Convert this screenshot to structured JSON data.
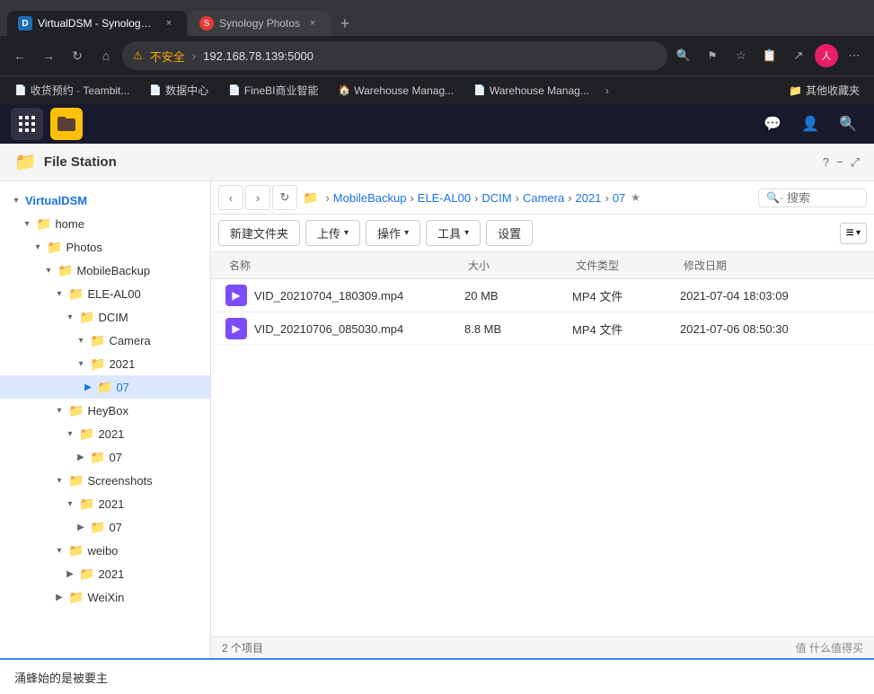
{
  "browser": {
    "tabs": [
      {
        "id": "tab1",
        "favicon_color": "#1a6fb5",
        "label": "VirtualDSM - Synology VirtualDS...",
        "active": true
      },
      {
        "id": "tab2",
        "favicon_color": "#e53935",
        "label": "Synology Photos",
        "active": false
      }
    ],
    "new_tab_label": "+",
    "address": {
      "warning_icon": "⚠",
      "warning_text": "不安全",
      "url": "192.168.78.139:5000"
    },
    "nav": {
      "back": "←",
      "forward": "→",
      "refresh": "↻",
      "home": "⌂"
    },
    "toolbar_icons": [
      "🔍",
      "⭐",
      "📋",
      "↗",
      "⋯"
    ],
    "bookmarks": [
      {
        "label": "收货预约 · Teambit..."
      },
      {
        "label": "数据中心"
      },
      {
        "label": "FineBI商业智能"
      },
      {
        "label": "Warehouse Manag..."
      },
      {
        "label": "Warehouse Manag..."
      }
    ],
    "bookmarks_more": "›",
    "bookmarks_folder": "其他收藏夹"
  },
  "dsm": {
    "taskbar": {
      "apps": [
        {
          "id": "grid",
          "icon": "⊞",
          "label": "应用菜单"
        },
        {
          "id": "filestation",
          "icon": "📁",
          "label": "File Station",
          "active": true
        }
      ],
      "right_icons": [
        "💬",
        "👤",
        "🔍"
      ]
    }
  },
  "file_station": {
    "title": "File Station",
    "header_icons": [
      "?",
      "−",
      "⤢"
    ],
    "sidebar": {
      "root": "VirtualDSM",
      "items": [
        {
          "id": "home",
          "label": "home",
          "indent": 2,
          "expanded": true,
          "has_arrow": true
        },
        {
          "id": "photos",
          "label": "Photos",
          "indent": 3,
          "expanded": true,
          "has_arrow": true
        },
        {
          "id": "mobilebackup",
          "label": "MobileBackup",
          "indent": 4,
          "expanded": true,
          "has_arrow": true
        },
        {
          "id": "eleal00",
          "label": "ELE-AL00",
          "indent": 5,
          "expanded": true,
          "has_arrow": true
        },
        {
          "id": "dcim",
          "label": "DCIM",
          "indent": 6,
          "expanded": true,
          "has_arrow": true
        },
        {
          "id": "camera",
          "label": "Camera",
          "indent": 7,
          "expanded": true,
          "has_arrow": true
        },
        {
          "id": "year2021",
          "label": "2021",
          "indent": 7,
          "expanded": true,
          "has_arrow": true
        },
        {
          "id": "month07",
          "label": "07",
          "indent": 7,
          "expanded": false,
          "has_arrow": true,
          "selected": true
        },
        {
          "id": "heybox",
          "label": "HeyBox",
          "indent": 5,
          "expanded": true,
          "has_arrow": true
        },
        {
          "id": "heybox2021",
          "label": "2021",
          "indent": 6,
          "expanded": true,
          "has_arrow": true
        },
        {
          "id": "heybox07",
          "label": "07",
          "indent": 7,
          "expanded": false,
          "has_arrow": true
        },
        {
          "id": "screenshots",
          "label": "Screenshots",
          "indent": 5,
          "expanded": true,
          "has_arrow": true
        },
        {
          "id": "screenshots2021",
          "label": "2021",
          "indent": 6,
          "expanded": true,
          "has_arrow": true
        },
        {
          "id": "screenshots07",
          "label": "07",
          "indent": 7,
          "expanded": false,
          "has_arrow": true
        },
        {
          "id": "weibo",
          "label": "weibo",
          "indent": 5,
          "expanded": true,
          "has_arrow": true
        },
        {
          "id": "weibo2021",
          "label": "2021",
          "indent": 6,
          "expanded": false,
          "has_arrow": true
        },
        {
          "id": "weixin",
          "label": "WeiXin",
          "indent": 5,
          "expanded": false,
          "has_arrow": true
        }
      ]
    },
    "path_bar": {
      "nav_back": "‹",
      "nav_forward": "›",
      "refresh": "↻",
      "folder_icon": "📁",
      "segments": [
        "MobileBackup",
        "ELE-AL00",
        "DCIM",
        "Camera",
        "2021",
        "07"
      ],
      "star": "★",
      "search_placeholder": "搜索",
      "search_icon": "🔍"
    },
    "action_bar": {
      "new_folder": "新建文件夹",
      "upload": "上传",
      "upload_arrow": "▾",
      "action": "操作",
      "action_arrow": "▾",
      "tools": "工具",
      "tools_arrow": "▾",
      "settings": "设置",
      "view_icon": "≡",
      "view_arrow": "▾"
    },
    "file_list": {
      "columns": [
        "名称",
        "大小",
        "文件类型",
        "修改日期"
      ],
      "files": [
        {
          "id": "file1",
          "name": "VID_20210704_180309.mp4",
          "size": "20 MB",
          "type": "MP4 文件",
          "date": "2021-07-04 18:03:09",
          "thumb_color": "#7c4dff"
        },
        {
          "id": "file2",
          "name": "VID_20210706_085030.mp4",
          "size": "8.8 MB",
          "type": "MP4 文件",
          "date": "2021-07-06 08:50:30",
          "thumb_color": "#7c4dff"
        }
      ]
    },
    "bottom_bar": {
      "count": "2 个项目"
    },
    "watermark": "值 什么值得买"
  },
  "chrome_bottom": {
    "text": "涌蜂始的是被要主"
  }
}
